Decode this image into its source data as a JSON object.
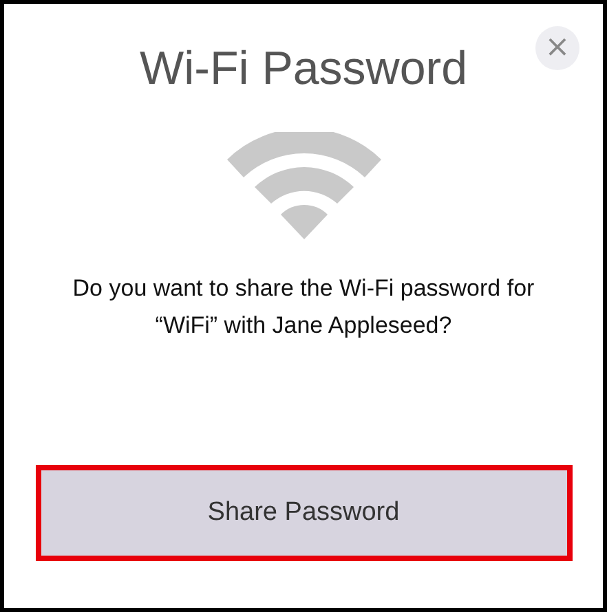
{
  "dialog": {
    "title": "Wi-Fi Password",
    "close_label": "×",
    "message": "Do you want to share the Wi-Fi password for “WiFi” with Jane Appleseed?"
  },
  "button": {
    "label": "Share Password",
    "highlighted": true
  }
}
